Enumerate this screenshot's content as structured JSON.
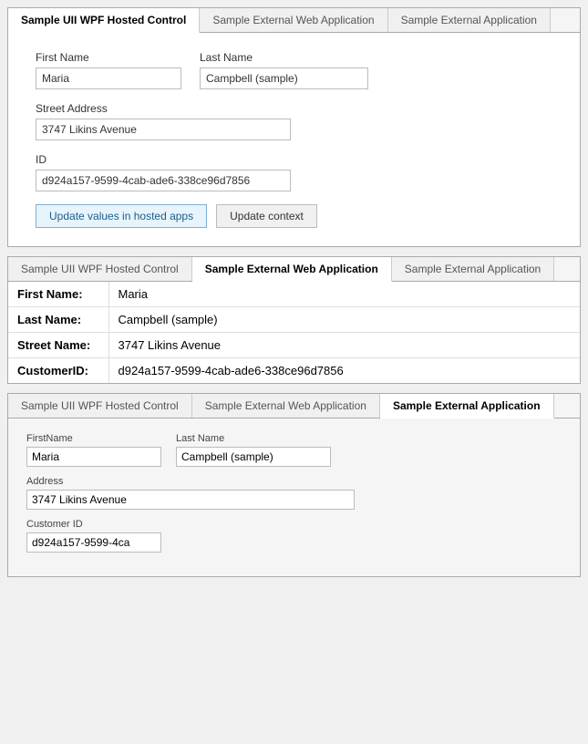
{
  "panel1": {
    "tabs": [
      {
        "id": "tab-wpf",
        "label": "Sample UII WPF Hosted Control",
        "active": true
      },
      {
        "id": "tab-web",
        "label": "Sample External Web Application",
        "active": false
      },
      {
        "id": "tab-ext",
        "label": "Sample External Application",
        "active": false
      }
    ],
    "fields": {
      "first_name_label": "First Name",
      "first_name_value": "Maria",
      "last_name_label": "Last Name",
      "last_name_value": "Campbell (sample)",
      "street_label": "Street Address",
      "street_value": "3747 Likins Avenue",
      "id_label": "ID",
      "id_value": "d924a157-9599-4cab-ade6-338ce96d7856"
    },
    "buttons": {
      "update_label": "Update values in hosted apps",
      "context_label": "Update context"
    }
  },
  "panel2": {
    "tabs": [
      {
        "id": "tab-wpf",
        "label": "Sample UII WPF Hosted Control",
        "active": false
      },
      {
        "id": "tab-web",
        "label": "Sample External Web Application",
        "active": true
      },
      {
        "id": "tab-ext",
        "label": "Sample External Application",
        "active": false
      }
    ],
    "rows": [
      {
        "label": "First Name:",
        "value": "Maria"
      },
      {
        "label": "Last Name:",
        "value": "Campbell (sample)"
      },
      {
        "label": "Street Name:",
        "value": "3747 Likins Avenue"
      },
      {
        "label": "CustomerID:",
        "value": "d924a157-9599-4cab-ade6-338ce96d7856"
      }
    ]
  },
  "panel3": {
    "tabs": [
      {
        "id": "tab-wpf",
        "label": "Sample UII WPF Hosted Control",
        "active": false
      },
      {
        "id": "tab-web",
        "label": "Sample External Web Application",
        "active": false
      },
      {
        "id": "tab-ext",
        "label": "Sample External Application",
        "active": true
      }
    ],
    "fields": {
      "first_name_label": "FirstName",
      "first_name_value": "Maria",
      "last_name_label": "Last Name",
      "last_name_value": "Campbell (sample)",
      "address_label": "Address",
      "address_value": "3747 Likins Avenue",
      "custid_label": "Customer ID",
      "custid_value": "d924a157-9599-4ca"
    }
  }
}
